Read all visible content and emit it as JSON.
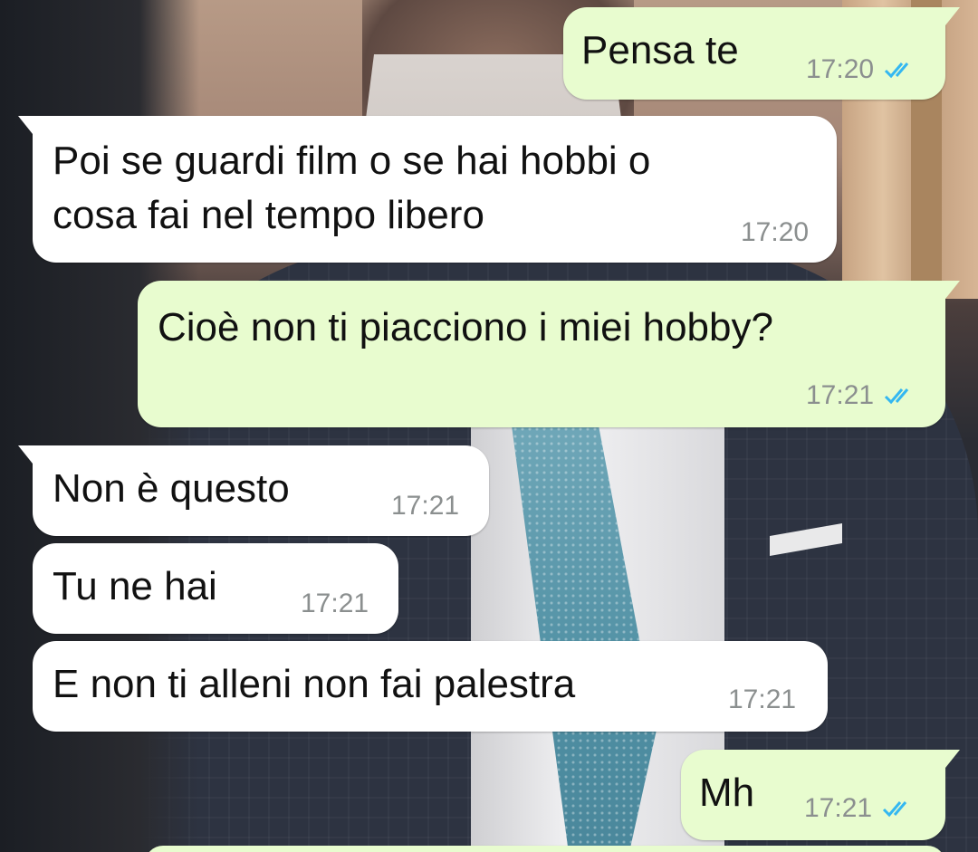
{
  "colors": {
    "incoming_bubble": "#ffffff",
    "outgoing_bubble": "#e8fccf",
    "timestamp": "#8b8f8f",
    "read_receipt": "#34b7f1"
  },
  "messages": [
    {
      "text": "Pensa te",
      "time": "17:20",
      "direction": "outgoing",
      "status_icon": "double-check-icon"
    },
    {
      "text": "Poi se guardi film o se hai hobbi o\ncosa fai nel tempo libero",
      "time": "17:20",
      "direction": "incoming"
    },
    {
      "text": "Cioè non ti piacciono i miei hobby?",
      "time": "17:21",
      "direction": "outgoing",
      "status_icon": "double-check-icon"
    },
    {
      "text": "Non è questo",
      "time": "17:21",
      "direction": "incoming"
    },
    {
      "text": "Tu ne hai",
      "time": "17:21",
      "direction": "incoming"
    },
    {
      "text": "E non ti alleni non fai palestra",
      "time": "17:21",
      "direction": "incoming"
    },
    {
      "text": "Mh",
      "time": "17:21",
      "direction": "outgoing",
      "status_icon": "double-check-icon"
    }
  ]
}
